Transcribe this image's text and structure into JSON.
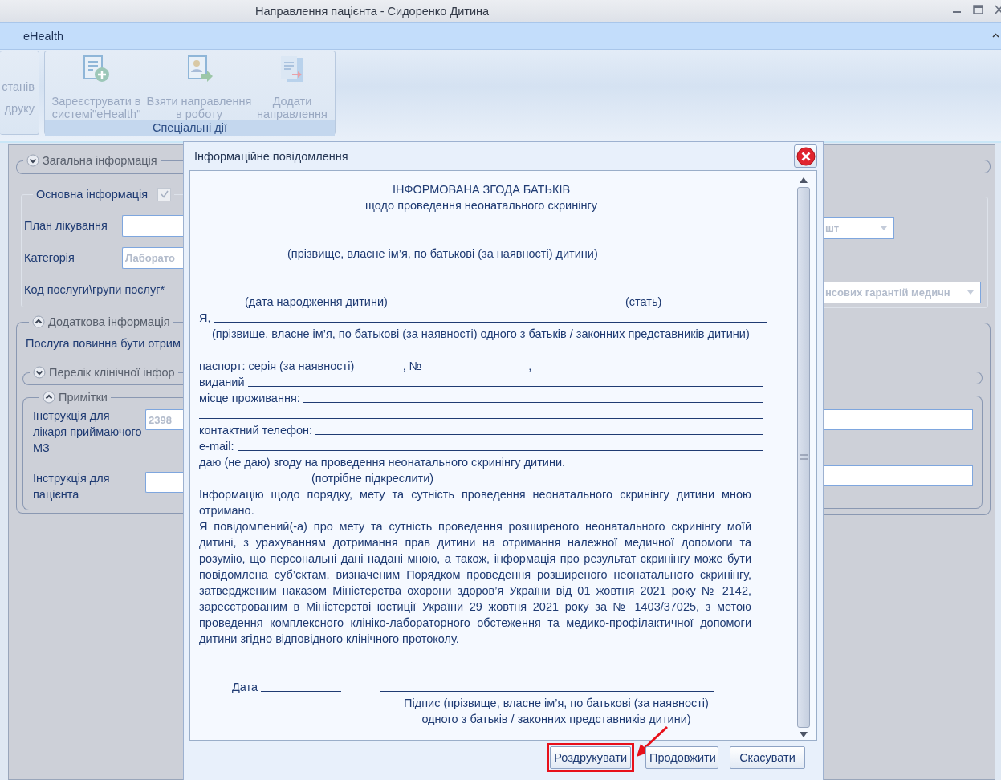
{
  "window": {
    "title": "Направлення пацієнта - Сидоренко Дитина"
  },
  "menu_tab": "eHealth",
  "ribbon": {
    "partial_labels": [
      "станів",
      "друку"
    ],
    "group": {
      "label": "Спеціальні дії",
      "buttons": [
        {
          "label": "Зареєструвати в\nсистемі\"eHealth\"",
          "kind": "register",
          "disabled": true
        },
        {
          "label": "Взяти направлення\nв роботу",
          "kind": "take",
          "disabled": true
        },
        {
          "label": "Додати\nнаправлення",
          "kind": "add",
          "disabled": true
        }
      ]
    }
  },
  "form": {
    "general": {
      "title": "Загальна інформація",
      "expanded": false
    },
    "basic": {
      "title": "Основна інформація",
      "checkbox": {
        "checked": true,
        "disabled": true
      },
      "rows": [
        {
          "label": "План лікування",
          "kind": "field"
        },
        {
          "label": "Категорія",
          "kind": "field",
          "value": "Лаборато"
        },
        {
          "label": "Код послуги\\групи послуг*",
          "kind": "text"
        }
      ],
      "unit_dropdown": {
        "value": "шт"
      },
      "service_dropdown": {
        "value": "нсових гарантій медичн"
      }
    },
    "additional": {
      "title": "Додаткова інформація",
      "expanded": true,
      "note": "Послуга повинна бути отрим",
      "clinical": {
        "title": "Перелік клінічної інфор",
        "expanded": false
      },
      "remarks": {
        "title": "Примітки",
        "expanded": true,
        "fields": [
          {
            "label": "Інструкція для лікаря приймаючого МЗ",
            "value": "2398"
          },
          {
            "label": "Інструкція для пацієнта"
          }
        ]
      }
    }
  },
  "dialog": {
    "title": "Інформаційне повідомлення",
    "document": {
      "title": "ІНФОРМОВАНА ЗГОДА БАТЬКІВ",
      "subtitle": "щодо проведення неонатального скринінгу",
      "child_caption": "(прізвище, власне ім’я, по батькові (за наявності) дитини)",
      "birth_caption": "(дата народження дитини)",
      "sex_caption": "(стать)",
      "parent_prefix": "Я,",
      "parent_caption": "(прізвище, власне ім’я, по батькові (за наявності) одного з батьків / законних представників дитини)",
      "passport": "паспорт: серія (за наявності) _______, № ________________,",
      "issued_label": "виданий",
      "residence_label": "місце проживання:",
      "phone_label": "контактний телефон:",
      "email_label": "e-mail:",
      "consent": "даю (не даю) згоду на проведення неонатального скринінгу дитини.",
      "consent_note": "(потрібне підкреслити)",
      "paragraphs": [
        "Інформацію щодо порядку, мету та сутність проведення неонатального скринінгу дитини мною отримано.",
        "Я повідомлений(-а) про мету та сутність проведення розширеного неонатального скринінгу моїй дитині, з урахуванням дотримання прав дитини на отримання належної медичної допомоги та розумію, що персональні дані надані мною, а також, інформація про результат скринінгу може бути повідомлена суб’єктам, визначеним Порядком проведення розширеного неонатального скринінгу, затвердженим наказом Міністерства охорони здоров’я України від 01 жовтня 2021 року № 2142, зареєстрованим в Міністерстві юстиції України 29 жовтня 2021 року за № 1403/37025, з метою проведення комплексного клініко-лабораторного обстеження та медико-профілактичної допомоги дитини згідно відповідного клінічного протоколу."
      ],
      "date_label": "Дата",
      "signature_caption": [
        "Підпис (прізвище, власне ім’я, по батькові (за наявності)",
        "одного з батьків / законних представників дитини)"
      ]
    },
    "buttons": [
      {
        "label": "Роздрукувати",
        "highlighted": true
      },
      {
        "label": "Продовжити",
        "highlighted": false
      },
      {
        "label": "Скасувати",
        "highlighted": false
      }
    ]
  }
}
